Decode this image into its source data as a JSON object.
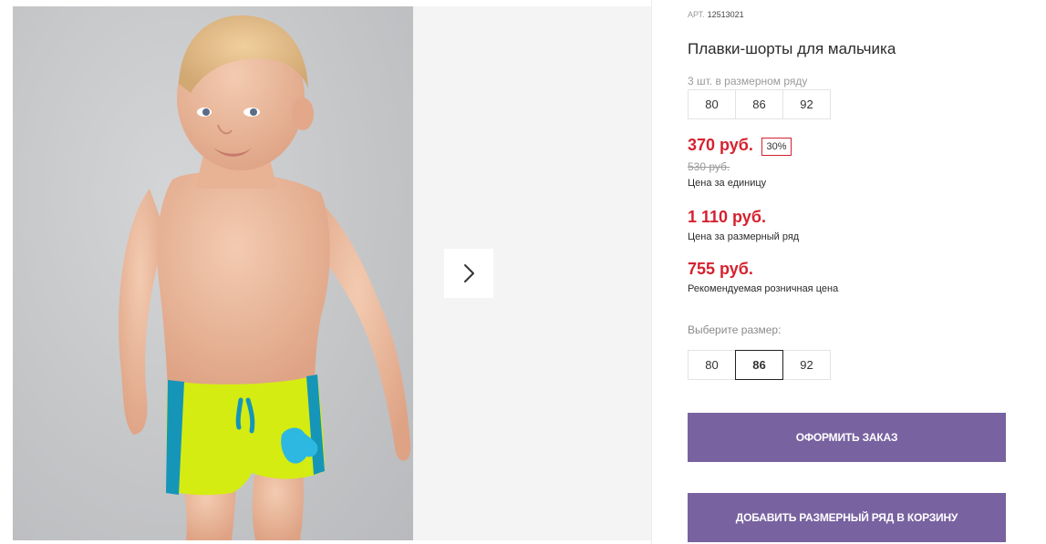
{
  "gallery": {
    "next_icon": "chevron-right-icon",
    "photo_description": "product-photo"
  },
  "product": {
    "art_label": "АРТ.",
    "art_number": "12513021",
    "title": "Плавки-шорты для мальчика",
    "series_count": "3 шт. в размерном ряду",
    "series_sizes": [
      "80",
      "86",
      "92"
    ],
    "unit_price": "370 руб.",
    "discount": "30%",
    "old_price": "530 руб.",
    "unit_price_caption": "Цена за единицу",
    "series_price": "1 110 руб.",
    "series_price_caption": "Цена за размерный ряд",
    "retail_price": "755 руб.",
    "retail_price_caption": "Рекомендуемая розничная цена",
    "choose_size_label": "Выберите размер:",
    "size_options": [
      "80",
      "86",
      "92"
    ],
    "selected_size": "86"
  },
  "actions": {
    "order_label": "Оформить заказ",
    "add_series_label": "Добавить размерный ряд в корзину"
  },
  "colors": {
    "price_red": "#d6212f",
    "button_purple": "#7862a0",
    "trunks_lime": "#d4ec12",
    "trunks_blue": "#1595b8"
  }
}
